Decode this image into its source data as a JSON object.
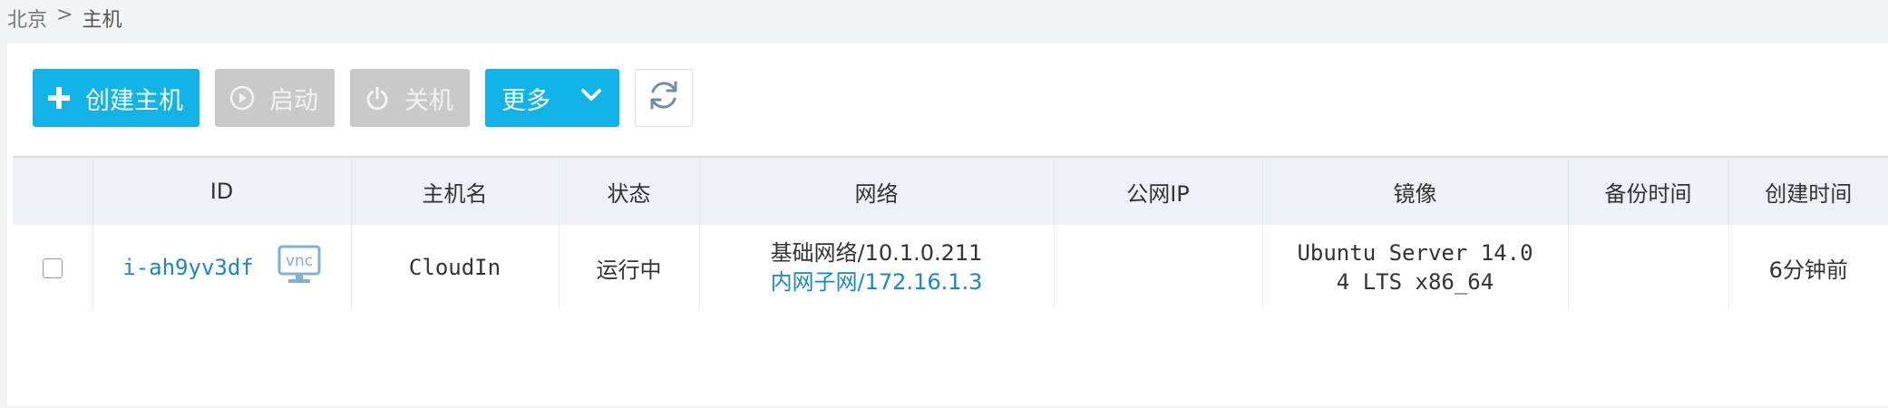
{
  "breadcrumb": {
    "region": "北京",
    "separator": ">",
    "current": "主机"
  },
  "toolbar": {
    "create_label": "创建主机",
    "start_label": "启动",
    "shutdown_label": "关机",
    "more_label": "更多"
  },
  "table": {
    "headers": {
      "id": "ID",
      "hostname": "主机名",
      "status": "状态",
      "network": "网络",
      "public_ip": "公网IP",
      "image": "镜像",
      "backup_time": "备份时间",
      "created_time": "创建时间"
    },
    "rows": [
      {
        "id": "i-ah9yv3df",
        "vnc_label": "vnc",
        "hostname": "CloudIn",
        "status": "运行中",
        "network_basic": "基础网络/10.1.0.211",
        "network_private": "内网子网/172.16.1.3",
        "public_ip": "",
        "image_line1": "Ubuntu Server 14.0",
        "image_line2": "4 LTS x86_64",
        "backup_time": "",
        "created_time": "6分钟前"
      }
    ]
  },
  "colors": {
    "primary": "#12b3e6",
    "disabled": "#c9c9c9",
    "link": "#1a86c9"
  }
}
